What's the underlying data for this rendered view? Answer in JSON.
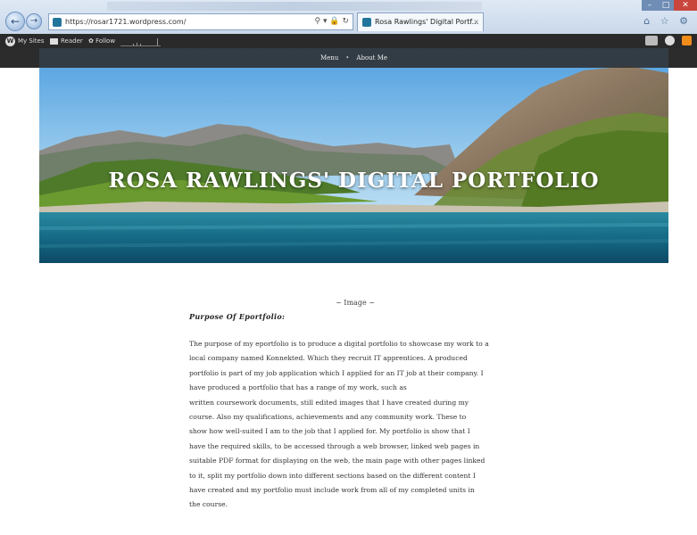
{
  "browser": {
    "url": "https://rosar1721.wordpress.com/",
    "tab_title": "Rosa Rawlings' Digital Portf...",
    "tab_close": "×",
    "back_glyph": "←",
    "forward_glyph": "→",
    "address_tools": "⚲ ▾ 🔒 ↻",
    "window_min": "–",
    "window_max": "□",
    "window_close": "✕",
    "toolbar_icons": "⌂ ☆ ⚙"
  },
  "adminbar": {
    "my_sites": "My Sites",
    "reader": "Reader",
    "follow": "✿ Follow",
    "wp_logo_glyph": "W"
  },
  "site": {
    "menu_items": [
      "Menu",
      "About Me"
    ],
    "menu_separator": "•",
    "title": "ROSA RAWLINGS' DIGITAL PORTFOLIO"
  },
  "content": {
    "image_caption": "~ Image ~",
    "heading": "Purpose Of Eportfolio:",
    "paragraph_lines": [
      "The purpose of my eportfolio is to produce a digital portfolio to showcase my work to a",
      "local company named Konnekted. Which they recruit IT apprentices. A produced",
      "portfolio is part of my job application which I applied for an IT job at their company. I",
      "have produced a portfolio that has a range of my work, such as",
      "written coursework documents, still edited images that I have created during my",
      "course. Also my qualifications, achievements and any community work. These to",
      "show how well-suited I am to the job that I applied for. My portfolio is show that I",
      "have the required skills, to be accessed through a web browser, linked web pages in",
      "suitable PDF format for displaying on the web, the main page with other pages linked",
      "to it, split my portfolio down into different sections based on the different content I",
      "have created and my portfolio must include work from all of my completed units in",
      "the course."
    ]
  },
  "colors": {
    "adminbar": "#2a2a2a",
    "menu_bar": "#2d2d2d",
    "wp_blue": "#21759b",
    "notification": "#f08c1a"
  },
  "icons": [
    "back-arrow-icon",
    "forward-arrow-icon",
    "search-icon",
    "lock-icon",
    "refresh-icon",
    "home-icon",
    "star-icon",
    "gear-icon",
    "wordpress-logo-icon",
    "reader-icon",
    "follow-icon",
    "write-icon",
    "avatar-icon",
    "notification-icon"
  ]
}
